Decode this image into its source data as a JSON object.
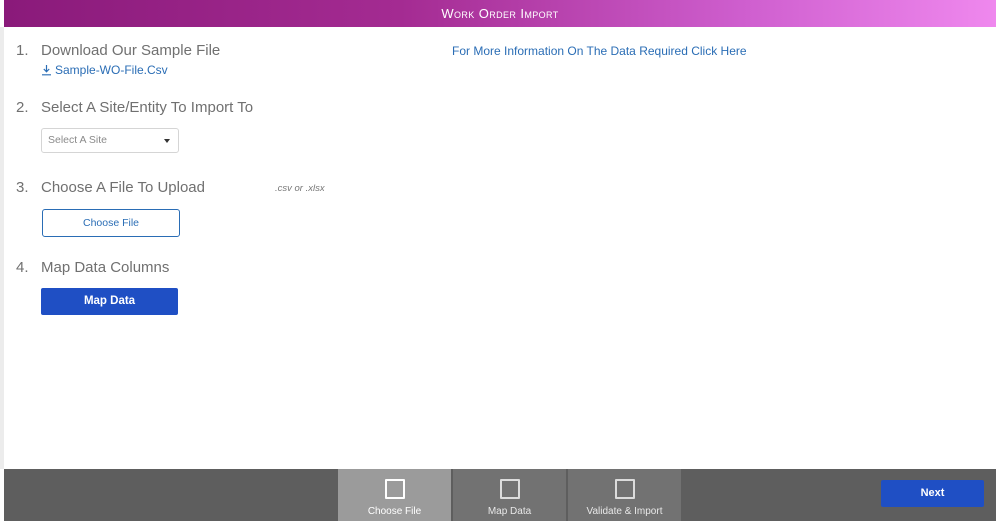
{
  "header": {
    "title": "Work Order Import"
  },
  "steps": [
    {
      "number": "1.",
      "title": "Download Our Sample File"
    },
    {
      "number": "2.",
      "title": "Select A Site/Entity To Import To"
    },
    {
      "number": "3.",
      "title": "Choose A File To Upload"
    },
    {
      "number": "4.",
      "title": "Map Data Columns"
    }
  ],
  "download": {
    "file_label": "Sample-WO-File.Csv",
    "icon": "download-icon"
  },
  "info_link": "For More Information On The Data Required Click Here",
  "site_select": {
    "selected": "Select A Site",
    "icon": "caret-down-icon"
  },
  "file_hint": ".csv or .xlsx",
  "choose_file_button": "Choose File",
  "map_data_button": "Map Data",
  "wizard": {
    "steps": [
      {
        "label": "Choose File",
        "active": true
      },
      {
        "label": "Map Data",
        "active": false
      },
      {
        "label": "Validate & Import",
        "active": false
      }
    ],
    "next_button": "Next"
  },
  "colors": {
    "accent_blue": "#1f4fc4",
    "link_blue": "#2a6db5",
    "header_start": "#8a1a7a",
    "header_end": "#ef88ee"
  }
}
